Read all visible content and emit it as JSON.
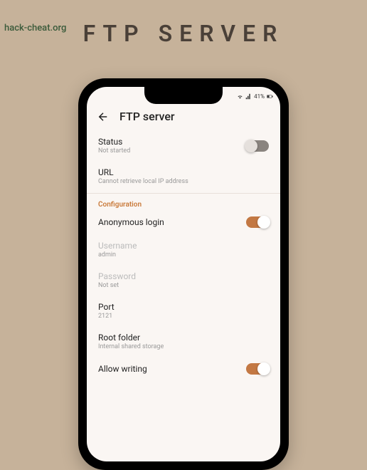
{
  "watermark": "hack-cheat.org",
  "page_title": "FTP SERVER",
  "status_bar": {
    "battery": "41%"
  },
  "header": {
    "title": "FTP server"
  },
  "status_row": {
    "title": "Status",
    "sub": "Not started",
    "toggle": false
  },
  "url_row": {
    "title": "URL",
    "sub": "Cannot retrieve local IP address"
  },
  "section": "Configuration",
  "anon_row": {
    "title": "Anonymous login",
    "toggle": true
  },
  "user_row": {
    "title": "Username",
    "sub": "admin"
  },
  "pass_row": {
    "title": "Password",
    "sub": "Not set"
  },
  "port_row": {
    "title": "Port",
    "sub": "2121"
  },
  "root_row": {
    "title": "Root folder",
    "sub": "Internal shared storage"
  },
  "write_row": {
    "title": "Allow writing",
    "toggle": true
  }
}
